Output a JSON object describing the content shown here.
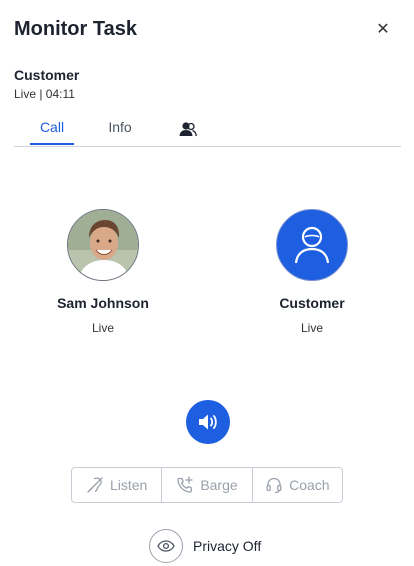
{
  "header": {
    "title": "Monitor Task",
    "close_icon": "close-icon"
  },
  "task": {
    "title": "Customer",
    "status": "Live | 04:11"
  },
  "tabs": [
    {
      "label": "Call",
      "active": true
    },
    {
      "label": "Info",
      "active": false
    },
    {
      "label": "",
      "icon": "participants-icon",
      "active": false
    }
  ],
  "participants": [
    {
      "name": "Sam Johnson",
      "status": "Live",
      "avatar": "photo"
    },
    {
      "name": "Customer",
      "status": "Live",
      "avatar": "person-icon"
    }
  ],
  "speaker": {
    "icon": "speaker-icon"
  },
  "modes": [
    {
      "label": "Listen",
      "icon": "listen-off-icon"
    },
    {
      "label": "Barge",
      "icon": "phone-plus-icon"
    },
    {
      "label": "Coach",
      "icon": "headset-icon"
    }
  ],
  "privacy": {
    "label": "Privacy Off",
    "icon": "eye-icon"
  },
  "colors": {
    "accent": "#1d5fe0",
    "disabled_text": "#9aa1ab",
    "border": "#c9ced6"
  }
}
